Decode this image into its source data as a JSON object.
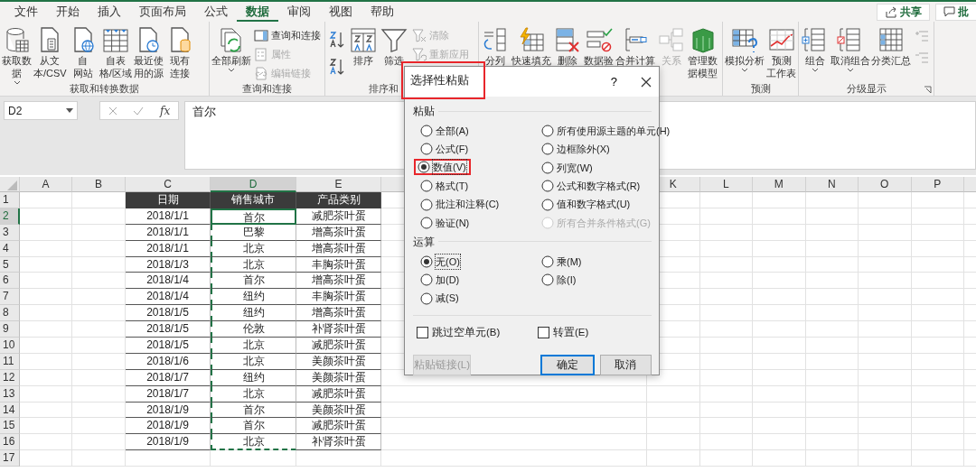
{
  "menu_tabs": [
    {
      "label": "文件",
      "selected": false
    },
    {
      "label": "开始",
      "selected": false
    },
    {
      "label": "插入",
      "selected": false
    },
    {
      "label": "页面布局",
      "selected": false
    },
    {
      "label": "公式",
      "selected": false
    },
    {
      "label": "数据",
      "selected": true
    },
    {
      "label": "审阅",
      "selected": false
    },
    {
      "label": "视图",
      "selected": false
    },
    {
      "label": "帮助",
      "selected": false
    }
  ],
  "top_buttons": [
    {
      "label": "共享"
    },
    {
      "label": "批"
    }
  ],
  "ribbon_groups": [
    {
      "label": "获取和转换数据",
      "buttons": [
        {
          "kind": "large",
          "lines": [
            "获取数",
            "据"
          ],
          "dropdown": true,
          "disabled": false
        },
        {
          "kind": "large",
          "lines": [
            "从文",
            "本/CSV"
          ],
          "disabled": false
        },
        {
          "kind": "large",
          "lines": [
            "自",
            "网站"
          ],
          "disabled": false
        },
        {
          "kind": "large",
          "lines": [
            "自表",
            "格/区域"
          ],
          "disabled": false
        },
        {
          "kind": "large",
          "lines": [
            "最近使",
            "用的源"
          ],
          "disabled": false
        },
        {
          "kind": "large",
          "lines": [
            "现有",
            "连接"
          ],
          "disabled": false
        }
      ]
    },
    {
      "label": "查询和连接",
      "buttons": [
        {
          "kind": "large",
          "lines": [
            "全部刷新"
          ],
          "dropdown": true,
          "disabled": false
        },
        {
          "kind": "small",
          "lines": [
            "查询和连接"
          ],
          "disabled": false
        },
        {
          "kind": "small",
          "lines": [
            "属性"
          ],
          "disabled": true
        },
        {
          "kind": "small",
          "lines": [
            "编辑链接"
          ],
          "disabled": true
        }
      ]
    },
    {
      "label": "排序和",
      "buttons": [
        {
          "kind": "icon",
          "disabled": false
        },
        {
          "kind": "icon",
          "disabled": false
        },
        {
          "kind": "large",
          "lines": [
            "排序"
          ],
          "disabled": false
        },
        {
          "kind": "large",
          "lines": [
            "筛选"
          ],
          "disabled": false
        },
        {
          "kind": "small",
          "lines": [
            "清除"
          ],
          "disabled": true
        },
        {
          "kind": "small",
          "lines": [
            "重新应用"
          ],
          "disabled": true
        }
      ]
    },
    {
      "buttons": [
        {
          "kind": "large",
          "lines": [
            "分列"
          ],
          "disabled": false
        },
        {
          "kind": "large",
          "lines": [
            "快速填充"
          ],
          "disabled": false
        },
        {
          "kind": "large",
          "lines": [
            "删除"
          ],
          "disabled": false
        },
        {
          "kind": "large",
          "lines": [
            "数据验"
          ],
          "disabled": false
        },
        {
          "kind": "large",
          "lines": [
            "合并计算"
          ],
          "disabled": false
        },
        {
          "kind": "large",
          "lines": [
            "关系"
          ],
          "disabled": true
        },
        {
          "kind": "large",
          "lines": [
            "管理数",
            "据模型"
          ],
          "disabled": false
        }
      ]
    },
    {
      "label": "预测",
      "buttons": [
        {
          "kind": "large",
          "lines": [
            "模拟分析"
          ],
          "dropdown": true,
          "disabled": false
        },
        {
          "kind": "large",
          "lines": [
            "预测",
            "工作表"
          ],
          "disabled": false
        }
      ]
    },
    {
      "label": "分级显示",
      "launcher": true,
      "buttons": [
        {
          "kind": "large",
          "lines": [
            "组合"
          ],
          "dropdown": true,
          "disabled": false
        },
        {
          "kind": "large",
          "lines": [
            "取消组合"
          ],
          "dropdown": true,
          "disabled": false
        },
        {
          "kind": "large",
          "lines": [
            "分类汇总"
          ],
          "disabled": false
        },
        {
          "kind": "icon",
          "disabled": true
        },
        {
          "kind": "icon",
          "disabled": true
        }
      ]
    }
  ],
  "name_box": "D2",
  "function_label": "fx",
  "formula": "首尔",
  "columns": [
    {
      "letter": "A",
      "selected": false
    },
    {
      "letter": "B",
      "selected": false
    },
    {
      "letter": "C",
      "selected": false
    },
    {
      "letter": "D",
      "selected": true
    },
    {
      "letter": "E",
      "selected": false
    },
    {
      "selected": false
    },
    {
      "letter": "K",
      "selected": false
    },
    {
      "letter": "L",
      "selected": false
    },
    {
      "letter": "M",
      "selected": false
    },
    {
      "letter": "N",
      "selected": false
    },
    {
      "letter": "O",
      "selected": false
    },
    {
      "letter": "P",
      "selected": false
    },
    {
      "selected": false
    }
  ],
  "rows": [
    {
      "number": "1",
      "kind": "header",
      "selected": false,
      "copied": false,
      "values": [
        "日期",
        "销售城市",
        "产品类别"
      ]
    },
    {
      "number": "2",
      "kind": "data",
      "selected": true,
      "copied": true,
      "values": [
        "2018/1/1",
        "首尔",
        "减肥茶叶蛋"
      ]
    },
    {
      "number": "3",
      "kind": "data",
      "selected": false,
      "copied": true,
      "values": [
        "2018/1/1",
        "巴黎",
        "增高茶叶蛋"
      ]
    },
    {
      "number": "4",
      "kind": "data",
      "selected": false,
      "copied": true,
      "values": [
        "2018/1/1",
        "北京",
        "增高茶叶蛋"
      ]
    },
    {
      "number": "5",
      "kind": "data",
      "selected": false,
      "copied": true,
      "values": [
        "2018/1/3",
        "北京",
        "丰胸茶叶蛋"
      ]
    },
    {
      "number": "6",
      "kind": "data",
      "selected": false,
      "copied": true,
      "values": [
        "2018/1/4",
        "首尔",
        "增高茶叶蛋"
      ]
    },
    {
      "number": "7",
      "kind": "data",
      "selected": false,
      "copied": true,
      "values": [
        "2018/1/4",
        "纽约",
        "丰胸茶叶蛋"
      ]
    },
    {
      "number": "8",
      "kind": "data",
      "selected": false,
      "copied": true,
      "values": [
        "2018/1/5",
        "纽约",
        "增高茶叶蛋"
      ]
    },
    {
      "number": "9",
      "kind": "data",
      "selected": false,
      "copied": true,
      "values": [
        "2018/1/5",
        "伦敦",
        "补肾茶叶蛋"
      ]
    },
    {
      "number": "10",
      "kind": "data",
      "selected": false,
      "copied": true,
      "values": [
        "2018/1/5",
        "北京",
        "减肥茶叶蛋"
      ]
    },
    {
      "number": "11",
      "kind": "data",
      "selected": false,
      "copied": true,
      "values": [
        "2018/1/6",
        "北京",
        "美颜茶叶蛋"
      ]
    },
    {
      "number": "12",
      "kind": "data",
      "selected": false,
      "copied": true,
      "values": [
        "2018/1/7",
        "纽约",
        "美颜茶叶蛋"
      ]
    },
    {
      "number": "13",
      "kind": "data",
      "selected": false,
      "copied": true,
      "values": [
        "2018/1/7",
        "北京",
        "减肥茶叶蛋"
      ]
    },
    {
      "number": "14",
      "kind": "data",
      "selected": false,
      "copied": true,
      "values": [
        "2018/1/9",
        "首尔",
        "美颜茶叶蛋"
      ]
    },
    {
      "number": "15",
      "kind": "data",
      "selected": false,
      "copied": true,
      "values": [
        "2018/1/9",
        "首尔",
        "减肥茶叶蛋"
      ]
    },
    {
      "number": "16",
      "kind": "data",
      "selected": false,
      "copied": true,
      "values": [
        "2018/1/9",
        "北京",
        "补肾茶叶蛋"
      ]
    },
    {
      "number": "17",
      "selected": false
    }
  ],
  "dialog": {
    "title": "选择性粘贴",
    "title_highlighted": true,
    "help": "?",
    "paste_label": "粘贴",
    "paste_options": [
      {
        "label": "全部(A)",
        "selected": false,
        "disabled": false,
        "highlighted": false
      },
      {
        "label": "所有使用源主题的单元(H)",
        "selected": false,
        "disabled": false,
        "highlighted": false
      },
      {
        "label": "公式(F)",
        "selected": false,
        "disabled": false,
        "highlighted": false
      },
      {
        "label": "边框除外(X)",
        "selected": false,
        "disabled": false,
        "highlighted": false
      },
      {
        "label": "数值(V)",
        "selected": true,
        "disabled": false,
        "highlighted": true
      },
      {
        "label": "列宽(W)",
        "selected": false,
        "disabled": false,
        "highlighted": false
      },
      {
        "label": "格式(T)",
        "selected": false,
        "disabled": false,
        "highlighted": false
      },
      {
        "label": "公式和数字格式(R)",
        "selected": false,
        "disabled": false,
        "highlighted": false
      },
      {
        "label": "批注和注释(C)",
        "selected": false,
        "disabled": false,
        "highlighted": false
      },
      {
        "label": "值和数字格式(U)",
        "selected": false,
        "disabled": false,
        "highlighted": false
      },
      {
        "label": "验证(N)",
        "selected": false,
        "disabled": false,
        "highlighted": false
      },
      {
        "label": "所有合并条件格式(G)",
        "selected": false,
        "disabled": true,
        "highlighted": false
      }
    ],
    "operation_label": "运算",
    "operation_options": [
      {
        "label": "无(O)",
        "selected": true,
        "disabled": false,
        "highlighted": false
      },
      {
        "label": "乘(M)",
        "selected": false,
        "disabled": false,
        "highlighted": false
      },
      {
        "label": "加(D)",
        "selected": false,
        "disabled": false,
        "highlighted": false
      },
      {
        "label": "除(I)",
        "selected": false,
        "disabled": false,
        "highlighted": false
      },
      {
        "label": "减(S)",
        "selected": false,
        "disabled": false,
        "highlighted": false
      }
    ],
    "checkboxes": [
      {
        "label": "跳过空单元(B)",
        "checked": false
      },
      {
        "label": "转置(E)",
        "checked": false
      }
    ],
    "buttons": [
      {
        "label": "粘贴链接(L)",
        "disabled": true,
        "default": false
      },
      {
        "label": "确定",
        "disabled": false,
        "default": true
      },
      {
        "label": "取消",
        "disabled": false,
        "default": false
      }
    ]
  }
}
